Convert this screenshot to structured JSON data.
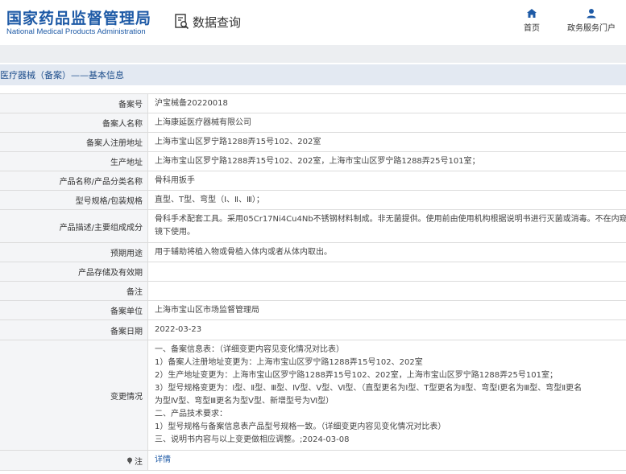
{
  "header": {
    "brand_cn": "国家药品监督管理局",
    "brand_en": "National Medical Products Administration",
    "query_label": "数据查询",
    "nav": {
      "home": "首页",
      "portal": "政务服务门户"
    }
  },
  "section_title": "医疗器械（备案）——基本信息",
  "rows": {
    "r0": {
      "label": "备案号",
      "value": "沪宝械备20220018"
    },
    "r1": {
      "label": "备案人名称",
      "value": "上海康延医疗器械有限公司"
    },
    "r2": {
      "label": "备案人注册地址",
      "value": "上海市宝山区罗宁路1288弄15号102、202室"
    },
    "r3": {
      "label": "生产地址",
      "value": "上海市宝山区罗宁路1288弄15号102、202室，上海市宝山区罗宁路1288弄25号101室；"
    },
    "r4": {
      "label": "产品名称/产品分类名称",
      "value": "骨科用扳手"
    },
    "r5": {
      "label": "型号规格/包装规格",
      "value": "直型、T型、弯型（Ⅰ、Ⅱ、Ⅲ）；"
    },
    "r6": {
      "label": "产品描述/主要组成成分",
      "line1": "骨科手术配套工具。采用05Cr17Ni4Cu4Nb不锈钢材料制成。非无菌提供。使用前由使用机构根据说明书进行灭菌或消毒。不在内窥",
      "line2": "镜下使用。"
    },
    "r7": {
      "label": "预期用途",
      "value": "用于辅助将植入物或骨植入体内或者从体内取出。"
    },
    "r8": {
      "label": "产品存储及有效期",
      "value": ""
    },
    "r9": {
      "label": "备注",
      "value": ""
    },
    "r10": {
      "label": "备案单位",
      "value": "上海市宝山区市场监督管理局"
    },
    "r11": {
      "label": "备案日期",
      "value": "2022-03-23"
    },
    "r12": {
      "label": "变更情况",
      "lines": [
        "一、备案信息表：（详细变更内容见变化情况对比表）",
        "1）备案人注册地址变更为：上海市宝山区罗宁路1288弄15号102、202室",
        "2）生产地址变更为：上海市宝山区罗宁路1288弄15号102、202室，上海市宝山区罗宁路1288弄25号101室；",
        "3）型号规格变更为：Ⅰ型、Ⅱ型、Ⅲ型、Ⅳ型、Ⅴ型、Ⅵ型、（直型更名为Ⅰ型、T型更名为Ⅱ型、弯型Ⅰ更名为Ⅲ型、弯型Ⅱ更名",
        "为型Ⅳ型、弯型Ⅲ更名为型Ⅴ型、新增型号为Ⅵ型）",
        "二、产品技术要求：",
        "1）型号规格与备案信息表产品型号规格一致。（详细变更内容见变化情况对比表）",
        "三、说明书内容与以上变更做相应调整。;2024-03-08"
      ]
    },
    "r13": {
      "label": "注",
      "value": "详情"
    }
  }
}
